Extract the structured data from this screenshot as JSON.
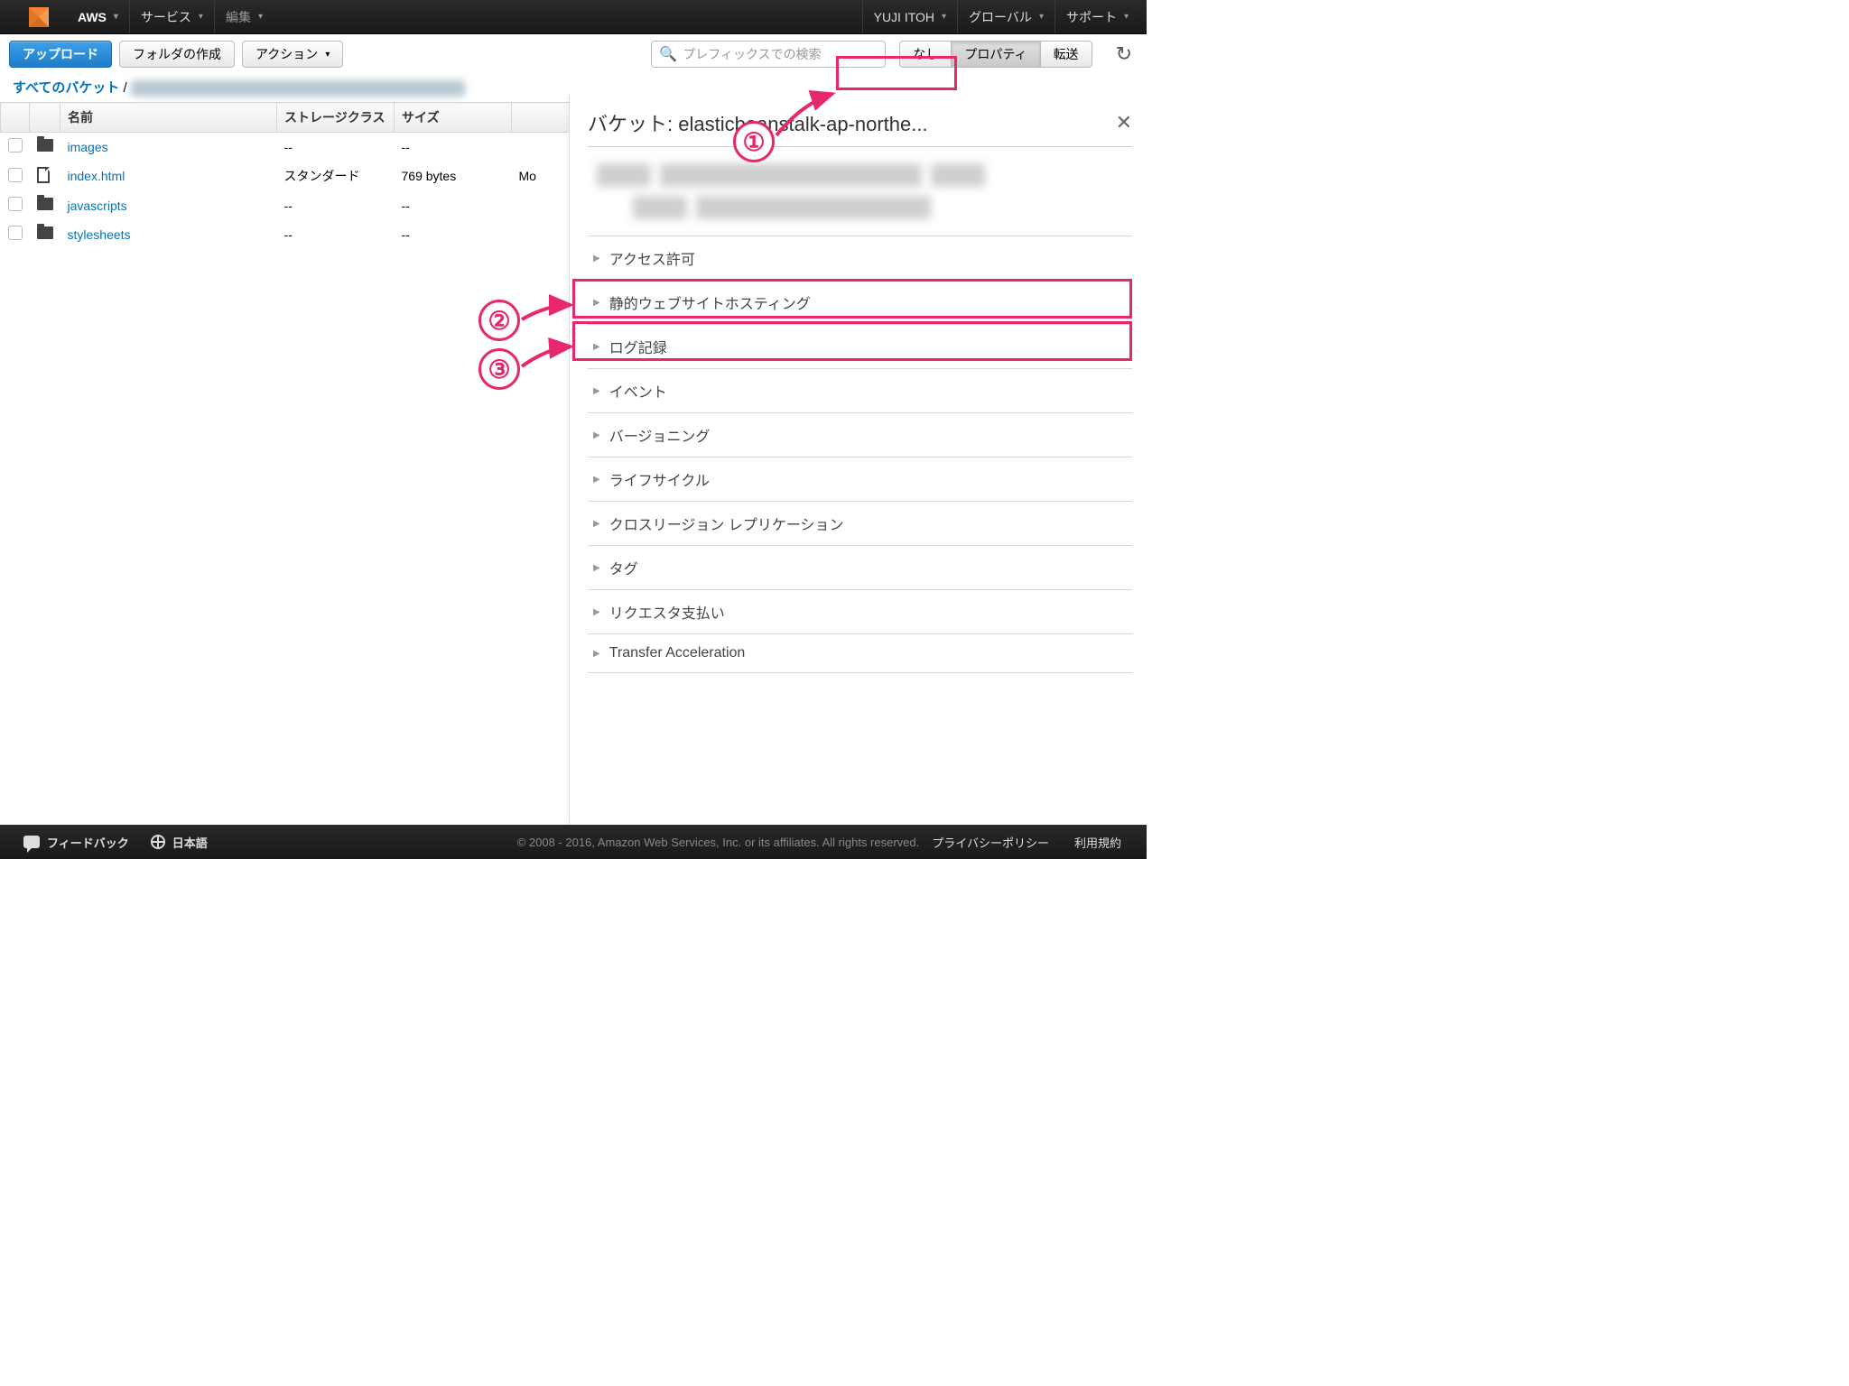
{
  "topnav": {
    "aws": "AWS",
    "services": "サービス",
    "edit": "編集",
    "user": "YUJI ITOH",
    "region": "グローバル",
    "support": "サポート"
  },
  "toolbar": {
    "upload": "アップロード",
    "createFolder": "フォルダの作成",
    "actions": "アクション",
    "searchPlaceholder": "プレフィックスでの検索",
    "tabNone": "なし",
    "tabProperties": "プロパティ",
    "tabTransfer": "転送"
  },
  "breadcrumb": {
    "all": "すべてのバケット",
    "sep": "/"
  },
  "columns": {
    "name": "名前",
    "storage": "ストレージクラス",
    "size": "サイズ"
  },
  "rows": [
    {
      "type": "folder",
      "name": "images",
      "storage": "--",
      "size": "--"
    },
    {
      "type": "file",
      "name": "index.html",
      "storage": "スタンダード",
      "size": "769 bytes",
      "extra": "Mo"
    },
    {
      "type": "folder",
      "name": "javascripts",
      "storage": "--",
      "size": "--"
    },
    {
      "type": "folder",
      "name": "stylesheets",
      "storage": "--",
      "size": "--"
    }
  ],
  "panel": {
    "title": "バケット: elasticbeanstalk-ap-northe...",
    "sections": [
      "アクセス許可",
      "静的ウェブサイトホスティング",
      "ログ記録",
      "イベント",
      "バージョニング",
      "ライフサイクル",
      "クロスリージョン レプリケーション",
      "タグ",
      "リクエスタ支払い",
      "Transfer Acceleration"
    ]
  },
  "footer": {
    "feedback": "フィードバック",
    "language": "日本語",
    "copyright": "© 2008 - 2016, Amazon Web Services, Inc. or its affiliates. All rights reserved.",
    "privacy": "プライバシーポリシー",
    "terms": "利用規約"
  },
  "anno": {
    "n1": "①",
    "n2": "②",
    "n3": "③"
  }
}
